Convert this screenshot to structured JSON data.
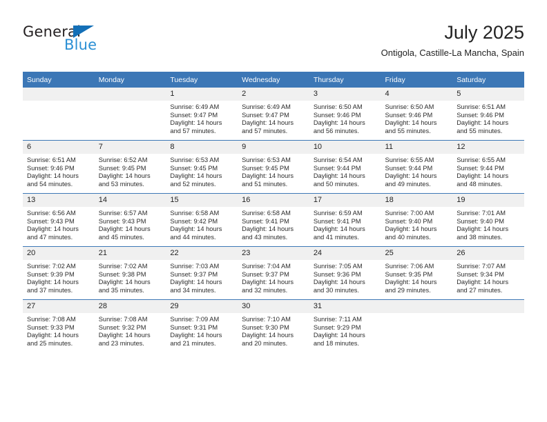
{
  "brand": {
    "word_one": "General",
    "word_two": "Blue",
    "triangle_icon": "triangle-icon",
    "accent_dark": "#136fb7",
    "accent_light": "#2a8fd4"
  },
  "header": {
    "title": "July 2025",
    "location": "Ontigola, Castille-La Mancha, Spain",
    "header_bg": "#3c77b6",
    "daynum_bg": "#f0f0f0"
  },
  "weekdays": [
    "Sunday",
    "Monday",
    "Tuesday",
    "Wednesday",
    "Thursday",
    "Friday",
    "Saturday"
  ],
  "weeks": [
    [
      {
        "day": "",
        "sunrise": "",
        "sunset": "",
        "daylight": ""
      },
      {
        "day": "",
        "sunrise": "",
        "sunset": "",
        "daylight": ""
      },
      {
        "day": "1",
        "sunrise": "Sunrise: 6:49 AM",
        "sunset": "Sunset: 9:47 PM",
        "daylight": "Daylight: 14 hours and 57 minutes."
      },
      {
        "day": "2",
        "sunrise": "Sunrise: 6:49 AM",
        "sunset": "Sunset: 9:47 PM",
        "daylight": "Daylight: 14 hours and 57 minutes."
      },
      {
        "day": "3",
        "sunrise": "Sunrise: 6:50 AM",
        "sunset": "Sunset: 9:46 PM",
        "daylight": "Daylight: 14 hours and 56 minutes."
      },
      {
        "day": "4",
        "sunrise": "Sunrise: 6:50 AM",
        "sunset": "Sunset: 9:46 PM",
        "daylight": "Daylight: 14 hours and 55 minutes."
      },
      {
        "day": "5",
        "sunrise": "Sunrise: 6:51 AM",
        "sunset": "Sunset: 9:46 PM",
        "daylight": "Daylight: 14 hours and 55 minutes."
      }
    ],
    [
      {
        "day": "6",
        "sunrise": "Sunrise: 6:51 AM",
        "sunset": "Sunset: 9:46 PM",
        "daylight": "Daylight: 14 hours and 54 minutes."
      },
      {
        "day": "7",
        "sunrise": "Sunrise: 6:52 AM",
        "sunset": "Sunset: 9:45 PM",
        "daylight": "Daylight: 14 hours and 53 minutes."
      },
      {
        "day": "8",
        "sunrise": "Sunrise: 6:53 AM",
        "sunset": "Sunset: 9:45 PM",
        "daylight": "Daylight: 14 hours and 52 minutes."
      },
      {
        "day": "9",
        "sunrise": "Sunrise: 6:53 AM",
        "sunset": "Sunset: 9:45 PM",
        "daylight": "Daylight: 14 hours and 51 minutes."
      },
      {
        "day": "10",
        "sunrise": "Sunrise: 6:54 AM",
        "sunset": "Sunset: 9:44 PM",
        "daylight": "Daylight: 14 hours and 50 minutes."
      },
      {
        "day": "11",
        "sunrise": "Sunrise: 6:55 AM",
        "sunset": "Sunset: 9:44 PM",
        "daylight": "Daylight: 14 hours and 49 minutes."
      },
      {
        "day": "12",
        "sunrise": "Sunrise: 6:55 AM",
        "sunset": "Sunset: 9:44 PM",
        "daylight": "Daylight: 14 hours and 48 minutes."
      }
    ],
    [
      {
        "day": "13",
        "sunrise": "Sunrise: 6:56 AM",
        "sunset": "Sunset: 9:43 PM",
        "daylight": "Daylight: 14 hours and 47 minutes."
      },
      {
        "day": "14",
        "sunrise": "Sunrise: 6:57 AM",
        "sunset": "Sunset: 9:43 PM",
        "daylight": "Daylight: 14 hours and 45 minutes."
      },
      {
        "day": "15",
        "sunrise": "Sunrise: 6:58 AM",
        "sunset": "Sunset: 9:42 PM",
        "daylight": "Daylight: 14 hours and 44 minutes."
      },
      {
        "day": "16",
        "sunrise": "Sunrise: 6:58 AM",
        "sunset": "Sunset: 9:41 PM",
        "daylight": "Daylight: 14 hours and 43 minutes."
      },
      {
        "day": "17",
        "sunrise": "Sunrise: 6:59 AM",
        "sunset": "Sunset: 9:41 PM",
        "daylight": "Daylight: 14 hours and 41 minutes."
      },
      {
        "day": "18",
        "sunrise": "Sunrise: 7:00 AM",
        "sunset": "Sunset: 9:40 PM",
        "daylight": "Daylight: 14 hours and 40 minutes."
      },
      {
        "day": "19",
        "sunrise": "Sunrise: 7:01 AM",
        "sunset": "Sunset: 9:40 PM",
        "daylight": "Daylight: 14 hours and 38 minutes."
      }
    ],
    [
      {
        "day": "20",
        "sunrise": "Sunrise: 7:02 AM",
        "sunset": "Sunset: 9:39 PM",
        "daylight": "Daylight: 14 hours and 37 minutes."
      },
      {
        "day": "21",
        "sunrise": "Sunrise: 7:02 AM",
        "sunset": "Sunset: 9:38 PM",
        "daylight": "Daylight: 14 hours and 35 minutes."
      },
      {
        "day": "22",
        "sunrise": "Sunrise: 7:03 AM",
        "sunset": "Sunset: 9:37 PM",
        "daylight": "Daylight: 14 hours and 34 minutes."
      },
      {
        "day": "23",
        "sunrise": "Sunrise: 7:04 AM",
        "sunset": "Sunset: 9:37 PM",
        "daylight": "Daylight: 14 hours and 32 minutes."
      },
      {
        "day": "24",
        "sunrise": "Sunrise: 7:05 AM",
        "sunset": "Sunset: 9:36 PM",
        "daylight": "Daylight: 14 hours and 30 minutes."
      },
      {
        "day": "25",
        "sunrise": "Sunrise: 7:06 AM",
        "sunset": "Sunset: 9:35 PM",
        "daylight": "Daylight: 14 hours and 29 minutes."
      },
      {
        "day": "26",
        "sunrise": "Sunrise: 7:07 AM",
        "sunset": "Sunset: 9:34 PM",
        "daylight": "Daylight: 14 hours and 27 minutes."
      }
    ],
    [
      {
        "day": "27",
        "sunrise": "Sunrise: 7:08 AM",
        "sunset": "Sunset: 9:33 PM",
        "daylight": "Daylight: 14 hours and 25 minutes."
      },
      {
        "day": "28",
        "sunrise": "Sunrise: 7:08 AM",
        "sunset": "Sunset: 9:32 PM",
        "daylight": "Daylight: 14 hours and 23 minutes."
      },
      {
        "day": "29",
        "sunrise": "Sunrise: 7:09 AM",
        "sunset": "Sunset: 9:31 PM",
        "daylight": "Daylight: 14 hours and 21 minutes."
      },
      {
        "day": "30",
        "sunrise": "Sunrise: 7:10 AM",
        "sunset": "Sunset: 9:30 PM",
        "daylight": "Daylight: 14 hours and 20 minutes."
      },
      {
        "day": "31",
        "sunrise": "Sunrise: 7:11 AM",
        "sunset": "Sunset: 9:29 PM",
        "daylight": "Daylight: 14 hours and 18 minutes."
      },
      {
        "day": "",
        "sunrise": "",
        "sunset": "",
        "daylight": ""
      },
      {
        "day": "",
        "sunrise": "",
        "sunset": "",
        "daylight": ""
      }
    ]
  ]
}
